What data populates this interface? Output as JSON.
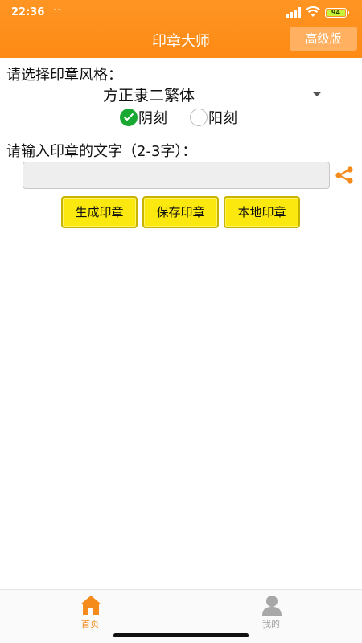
{
  "status_bar": {
    "time": "22:36",
    "dots": "··",
    "battery": "94"
  },
  "header": {
    "title": "印章大师",
    "advanced_button": "高级版"
  },
  "style_section": {
    "label": "请选择印章风格：",
    "font_selected": "方正隶二繁体",
    "radio_options": [
      {
        "label": "阴刻",
        "checked": true
      },
      {
        "label": "阳刻",
        "checked": false
      }
    ]
  },
  "text_section": {
    "label": "请输入印章的文字（2-3字）：",
    "input_value": "",
    "input_placeholder": ""
  },
  "buttons": {
    "generate": "生成印章",
    "save": "保存印章",
    "local": "本地印章"
  },
  "tabbar": {
    "items": [
      {
        "label": "首页",
        "active": true
      },
      {
        "label": "我的",
        "active": false
      }
    ]
  },
  "colors": {
    "header": "#fd8a14",
    "button_yellow": "#fbe80f",
    "radio_checked": "#19a832",
    "tab_active": "#f58b1b",
    "tab_inactive": "#a0a0a0"
  }
}
